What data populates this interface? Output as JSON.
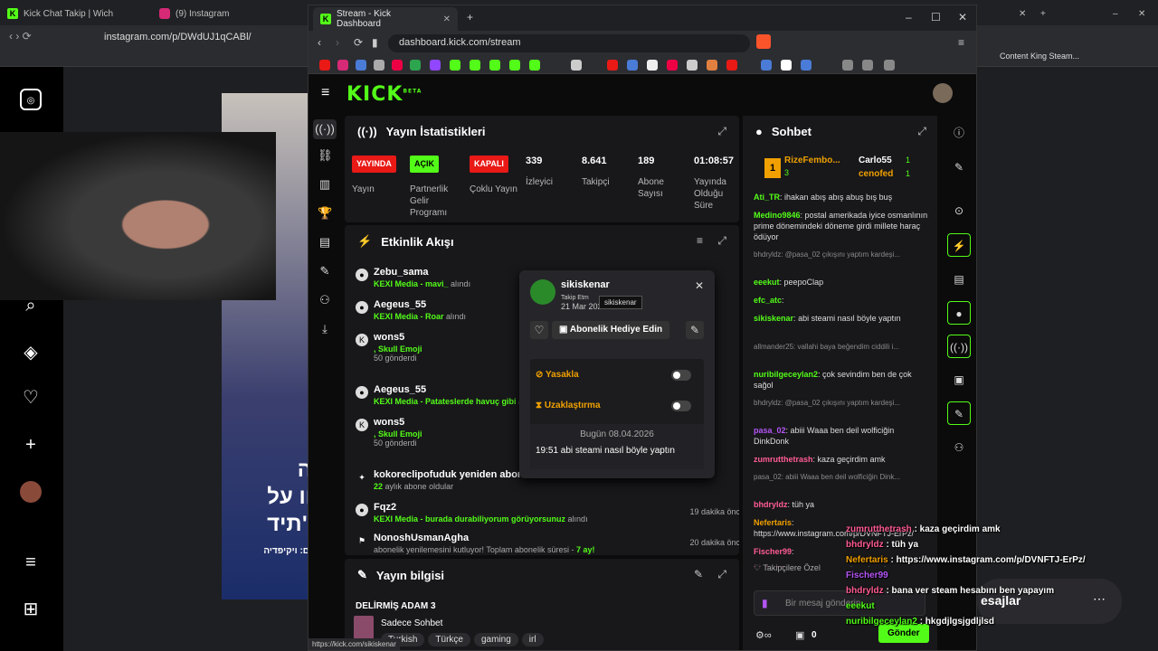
{
  "background_browser": {
    "tabs": [
      "Kick Chat Takip | Wich",
      "(9) Instagram"
    ],
    "url": "instagram.com/p/DWdUJ1qCABl/",
    "bookmark_right": "Content King Steam...",
    "hebrew_lines": [
      "ה",
      "וו על",
      "תיד\"",
      "ום: ויקיפדיה"
    ],
    "right_label": "esajlar"
  },
  "window": {
    "tab_title": "Stream - Kick Dashboard",
    "url": "dashboard.kick.com/stream",
    "status_url": "https://kick.com/sikiskenar"
  },
  "kick": {
    "logo": "KICK",
    "logo_sup": "BETA",
    "stats": {
      "title": "Yayın İstatistikleri",
      "items": [
        {
          "badge": "YAYINDA",
          "badge_color": "#e91916",
          "label": "Yayın"
        },
        {
          "badge": "AÇIK",
          "badge_color": "#53fc18",
          "label": "Partnerlik Gelir Programı"
        },
        {
          "badge": "KAPALI",
          "badge_color": "#e91916",
          "label": "Çoklu Yayın"
        },
        {
          "value": "339",
          "label": "İzleyici"
        },
        {
          "value": "8.641",
          "label": "Takipçi"
        },
        {
          "value": "189",
          "label": "Abone Sayısı"
        },
        {
          "value": "01:08:57",
          "label": "Yayında Olduğu Süre"
        }
      ]
    },
    "activity": {
      "title": "Etkinlik Akışı",
      "events": [
        {
          "name": "Zebu_sama",
          "sub": "KEXI Media - mavi_",
          "tail": "alındı",
          "time": ""
        },
        {
          "name": "Aegeus_55",
          "sub": "KEXI Media - Roar",
          "tail": "alındı",
          "time": ""
        },
        {
          "name": "wons5",
          "sub": ", Skull Emoji",
          "tail": "50 gönderdi",
          "time": ""
        },
        {
          "name": "Aegeus_55",
          "sub": "KEXI Media - Patateslerde havuç gibi",
          "tail": "al",
          "time": ""
        },
        {
          "name": "wons5",
          "sub": ", Skull Emoji",
          "tail": "50 gönderdi",
          "time": ""
        },
        {
          "name": "kokoreclipofuduk yeniden abone o",
          "sub": "22",
          "tail": "aylık abone oldular",
          "time": ""
        },
        {
          "name": "Fqz2",
          "sub": "KEXI Media - burada durabiliyorum görüyorsunuz",
          "tail": "alındı",
          "time": "19 dakika önce"
        },
        {
          "name": "NonoshUsmanAgha",
          "sub": "abonelik yenilemesini kutluyor! Toplam abonelik süresi -",
          "tail": "7 ay!",
          "time": "20 dakika önce"
        }
      ]
    },
    "popup": {
      "username": "sikiskenar",
      "followed_label": "Takip Etm",
      "followed_date": "21 Mar 202",
      "tooltip": "sikiskenar",
      "gift_label": "Abonelik Hediye Edin",
      "ban_label": "Yasakla",
      "timeout_label": "Uzaklaştırma",
      "date_line": "Bugün 08.04.2026",
      "message": "19:51 abi steami nasıl böyle yaptın"
    },
    "stream_info": {
      "title": "Yayın bilgisi",
      "stream_title": "DELİRMİŞ ADAM 3",
      "category": "Sadece Sohbet",
      "tags": [
        "Turkish",
        "Türkçe",
        "gaming",
        "irl"
      ]
    },
    "chat": {
      "title": "Sohbet",
      "top_gifters": [
        {
          "name": "RizeFembo...",
          "count": "3"
        },
        {
          "name": "Carlo55",
          "count": "1"
        },
        {
          "name": "cenofed",
          "count": "1"
        }
      ],
      "messages": [
        {
          "user": "Ati_TR",
          "color": "#53fc18",
          "text": "ihakan abış abış abuş bış buş",
          "gray": false
        },
        {
          "user": "Medino9846",
          "color": "#53fc18",
          "text": "postal amerikada iyice osmanlının prime dönemindeki döneme girdi millete haraç ödüyor",
          "gray": false
        },
        {
          "user": "",
          "color": "#888",
          "text": "bhdryldz: @pasa_02 çıkışını yaptım kardeşi...",
          "gray": true
        },
        {
          "user": "eeekut",
          "color": "#53fc18",
          "text": "peepoClap",
          "gray": false
        },
        {
          "user": "efc_atc",
          "color": "#53fc18",
          "text": "",
          "gray": false
        },
        {
          "user": "sikiskenar",
          "color": "#53fc18",
          "text": "abi steami nasıl böyle yaptın",
          "gray": false
        },
        {
          "user": "",
          "color": "#888",
          "text": "allmander25: vallahi baya beğendim ciddili i...",
          "gray": true
        },
        {
          "user": "nuribilgeceylan2",
          "color": "#53fc18",
          "text": "çok sevindim ben de çok sağol",
          "gray": false
        },
        {
          "user": "",
          "color": "#888",
          "text": "bhdryldz: @pasa_02 çıkışını yaptım kardeşi...",
          "gray": true
        },
        {
          "user": "pasa_02",
          "color": "#b455f5",
          "text": "abiii Waaa ben deil wolficiğin DinkDonk",
          "gray": false
        },
        {
          "user": "zumrutthetrash",
          "color": "#ff5c93",
          "text": "kaza geçirdim amk",
          "gray": false
        },
        {
          "user": "",
          "color": "#888",
          "text": "pasa_02: abiii Waaa ben deil wolficiğin Dink...",
          "gray": true
        },
        {
          "user": "bhdryldz",
          "color": "#ff5c93",
          "text": "tüh ya",
          "gray": false
        },
        {
          "user": "Nefertaris",
          "color": "#f0a000",
          "text": "https://www.instagram.com/p/DVNFTJ-ErPz/",
          "gray": false
        },
        {
          "user": "Fischer99",
          "color": "#ff5c93",
          "text": "",
          "gray": false
        },
        {
          "user": "bhdryldz",
          "color": "#ff5c93",
          "text": "bana ver steam hesabını ben yapayım",
          "gray": false
        },
        {
          "user": "eeekut",
          "color": "#53fc18",
          "text": "",
          "gray": false
        },
        {
          "user": "nuribilgeceylan2",
          "color": "#53fc18",
          "text": "hkgdjlgsjgdljlsd",
          "gray": false
        }
      ],
      "followers_only": "Takipçilere Özel",
      "input_placeholder": "Bir mesaj gönderin",
      "send_label": "Gönder",
      "footer_count": "0"
    },
    "overlay": {
      "lines": [
        {
          "user": "zumrutthetrash",
          "color": "#ff5c93",
          "text": "kaza geçirdim amk"
        },
        {
          "user": "bhdryldz",
          "color": "#ff5c93",
          "text": "tüh ya"
        },
        {
          "user": "Nefertaris",
          "color": "#f0a000",
          "text": "https://www.instagram.com/p/DVNFTJ-ErPz/"
        },
        {
          "user": "Fischer99",
          "color": "#b455f5",
          "text": ""
        },
        {
          "user": "bhdryldz",
          "color": "#ff5c93",
          "text": "bana ver steam hesabını ben yapayım"
        },
        {
          "user": "eeekut",
          "color": "#53fc18",
          "text": ""
        },
        {
          "user": "nuribilgeceylan2",
          "color": "#53fc18",
          "text": "hkgdjlgsjgdljlsd"
        }
      ]
    }
  }
}
